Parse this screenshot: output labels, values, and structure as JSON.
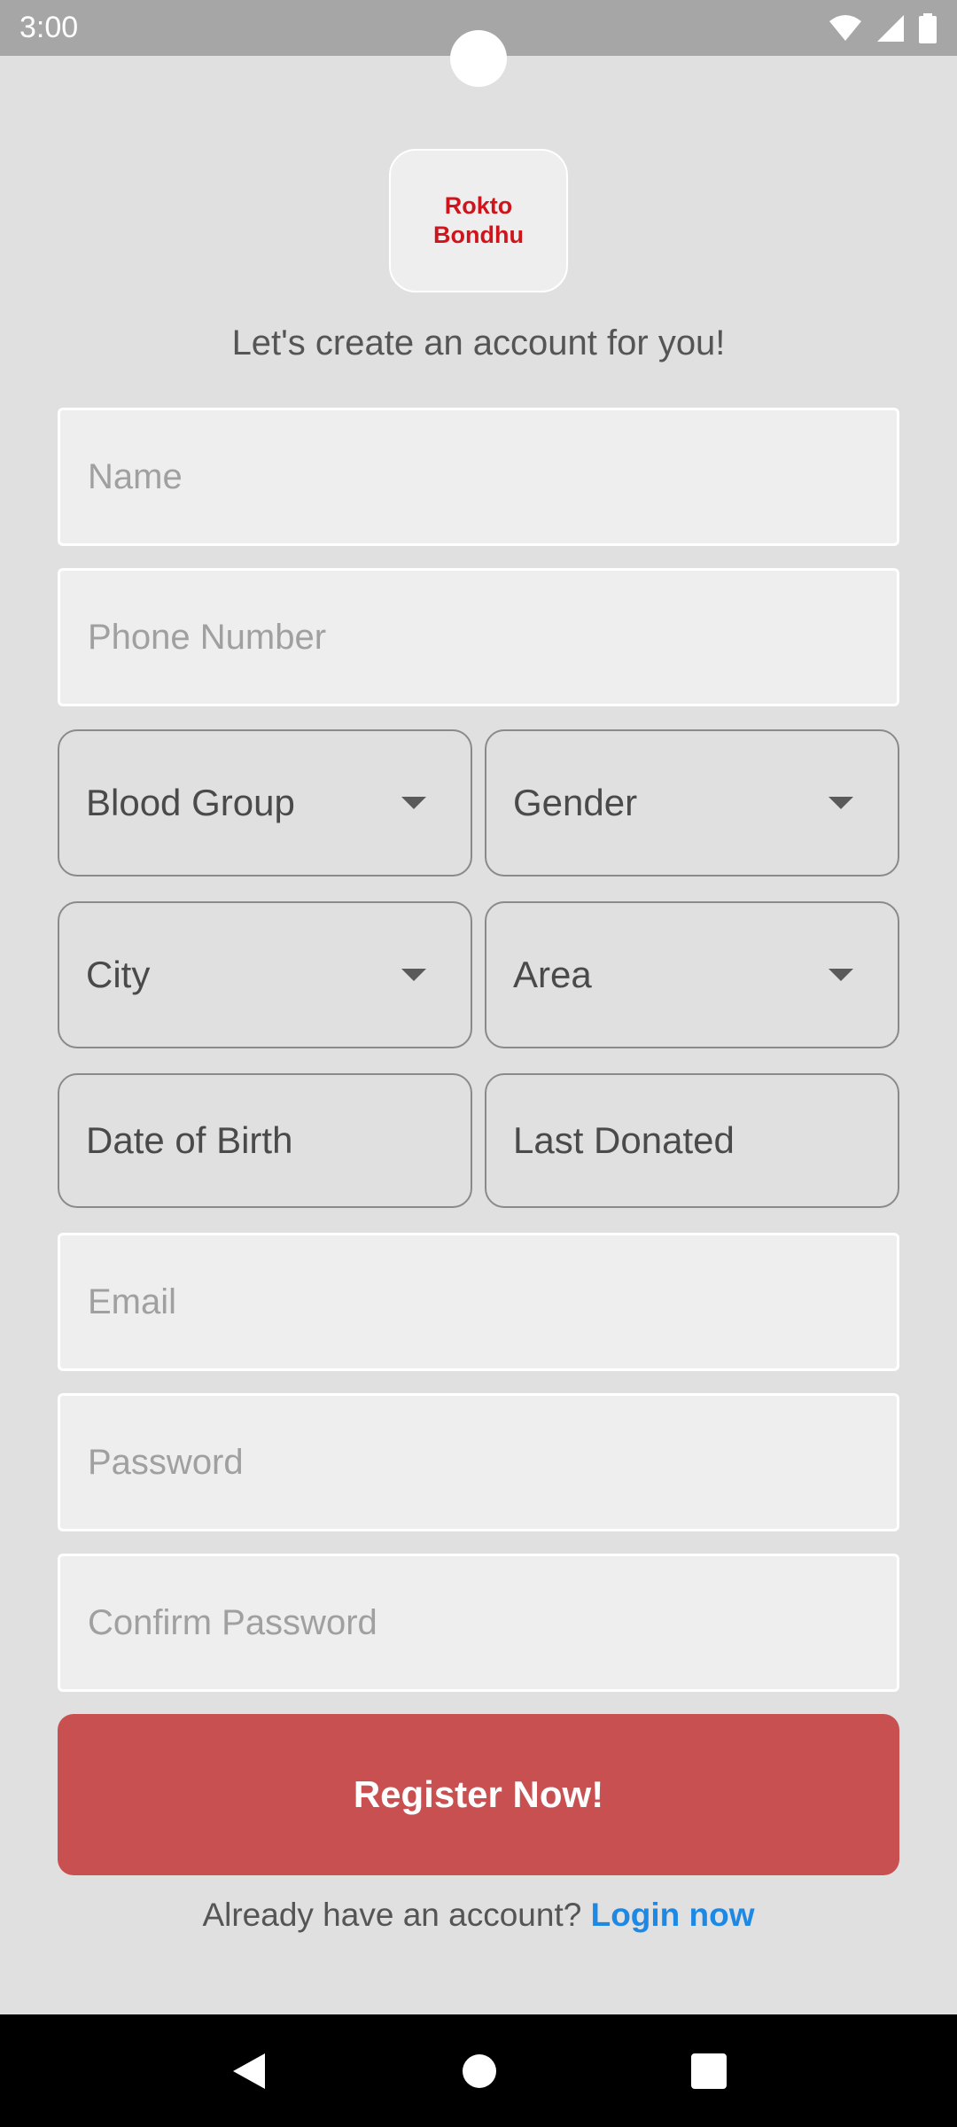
{
  "status_bar": {
    "time": "3:00",
    "icons": [
      "wifi-icon",
      "signal-icon",
      "battery-icon"
    ]
  },
  "logo": {
    "line1": "Rokto",
    "line2": "Bondhu"
  },
  "subtitle": "Let's create an account for you!",
  "fields": {
    "name": {
      "placeholder": "Name",
      "value": ""
    },
    "phone": {
      "placeholder": "Phone Number",
      "value": ""
    },
    "email": {
      "placeholder": "Email",
      "value": ""
    },
    "password": {
      "placeholder": "Password",
      "value": ""
    },
    "confirm_password": {
      "placeholder": "Confirm Password",
      "value": ""
    }
  },
  "dropdowns": {
    "blood_group": "Blood Group",
    "gender": "Gender",
    "city": "City",
    "area": "Area"
  },
  "date_fields": {
    "dob": "Date of Birth",
    "last_donated": "Last Donated"
  },
  "register_button": "Register Now!",
  "login_prompt": {
    "text": "Already have an account?",
    "link": "Login now"
  },
  "colors": {
    "brand_red": "#d0141c",
    "button_red": "#c85050",
    "link_blue": "#1e88e5",
    "background": "#e0e0e0"
  },
  "nav_bar": {
    "buttons": [
      "back-icon",
      "home-icon",
      "recents-icon"
    ]
  }
}
